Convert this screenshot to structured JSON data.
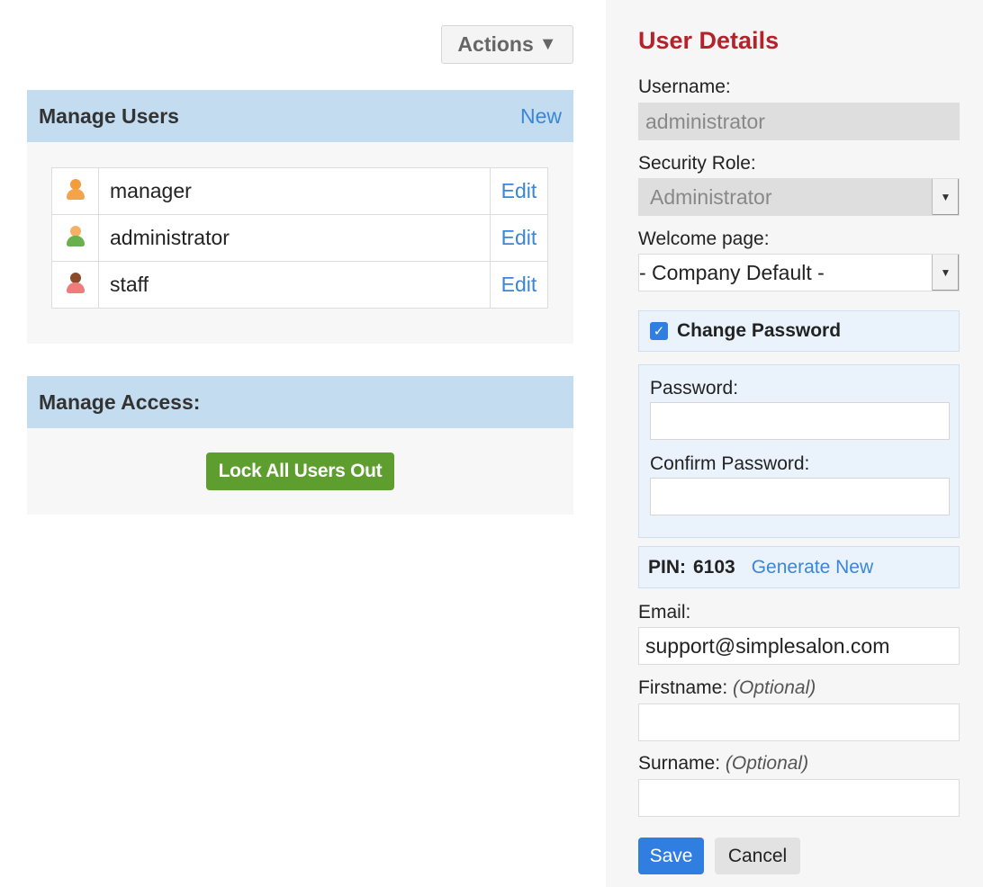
{
  "actions": {
    "label": "Actions",
    "caret": "▼",
    "caret_icon": "triangle-down-icon"
  },
  "manage_users": {
    "title": "Manage Users",
    "new_label": "New",
    "users": [
      {
        "name": "manager",
        "edit": "Edit",
        "icon": "user-icon",
        "head_color": "#f39c3c",
        "body_color": "#f5a34a"
      },
      {
        "name": "administrator",
        "edit": "Edit",
        "icon": "user-icon",
        "head_color": "#f0b266",
        "body_color": "#6ab04c"
      },
      {
        "name": "staff",
        "edit": "Edit",
        "icon": "user-icon",
        "head_color": "#8a4b2a",
        "body_color": "#f07b7b"
      }
    ]
  },
  "manage_access": {
    "title": "Manage Access:",
    "lock_label": "Lock All Users Out"
  },
  "user_details": {
    "title": "User Details",
    "username_label": "Username:",
    "username_value": "administrator",
    "role_label": "Security Role:",
    "role_value": "Administrator",
    "welcome_label": "Welcome page:",
    "welcome_value": "- Company Default -",
    "change_password_label": "Change Password",
    "change_password_checked": true,
    "password_label": "Password:",
    "password_value": "",
    "confirm_label": "Confirm Password:",
    "confirm_value": "",
    "pin_label": "PIN:",
    "pin_value": "6103",
    "generate_label": "Generate New",
    "email_label": "Email:",
    "email_value": "support@simplesalon.com",
    "firstname_label": "Firstname:",
    "firstname_optional": "(Optional)",
    "firstname_value": "",
    "surname_label": "Surname:",
    "surname_optional": "(Optional)",
    "surname_value": "",
    "save_label": "Save",
    "cancel_label": "Cancel"
  },
  "colors": {
    "accent": "#2f7ee0",
    "link": "#3a86d8",
    "title_red": "#b5222a",
    "header_blue": "#c3dcef",
    "lock_green": "#5e9e2e"
  }
}
